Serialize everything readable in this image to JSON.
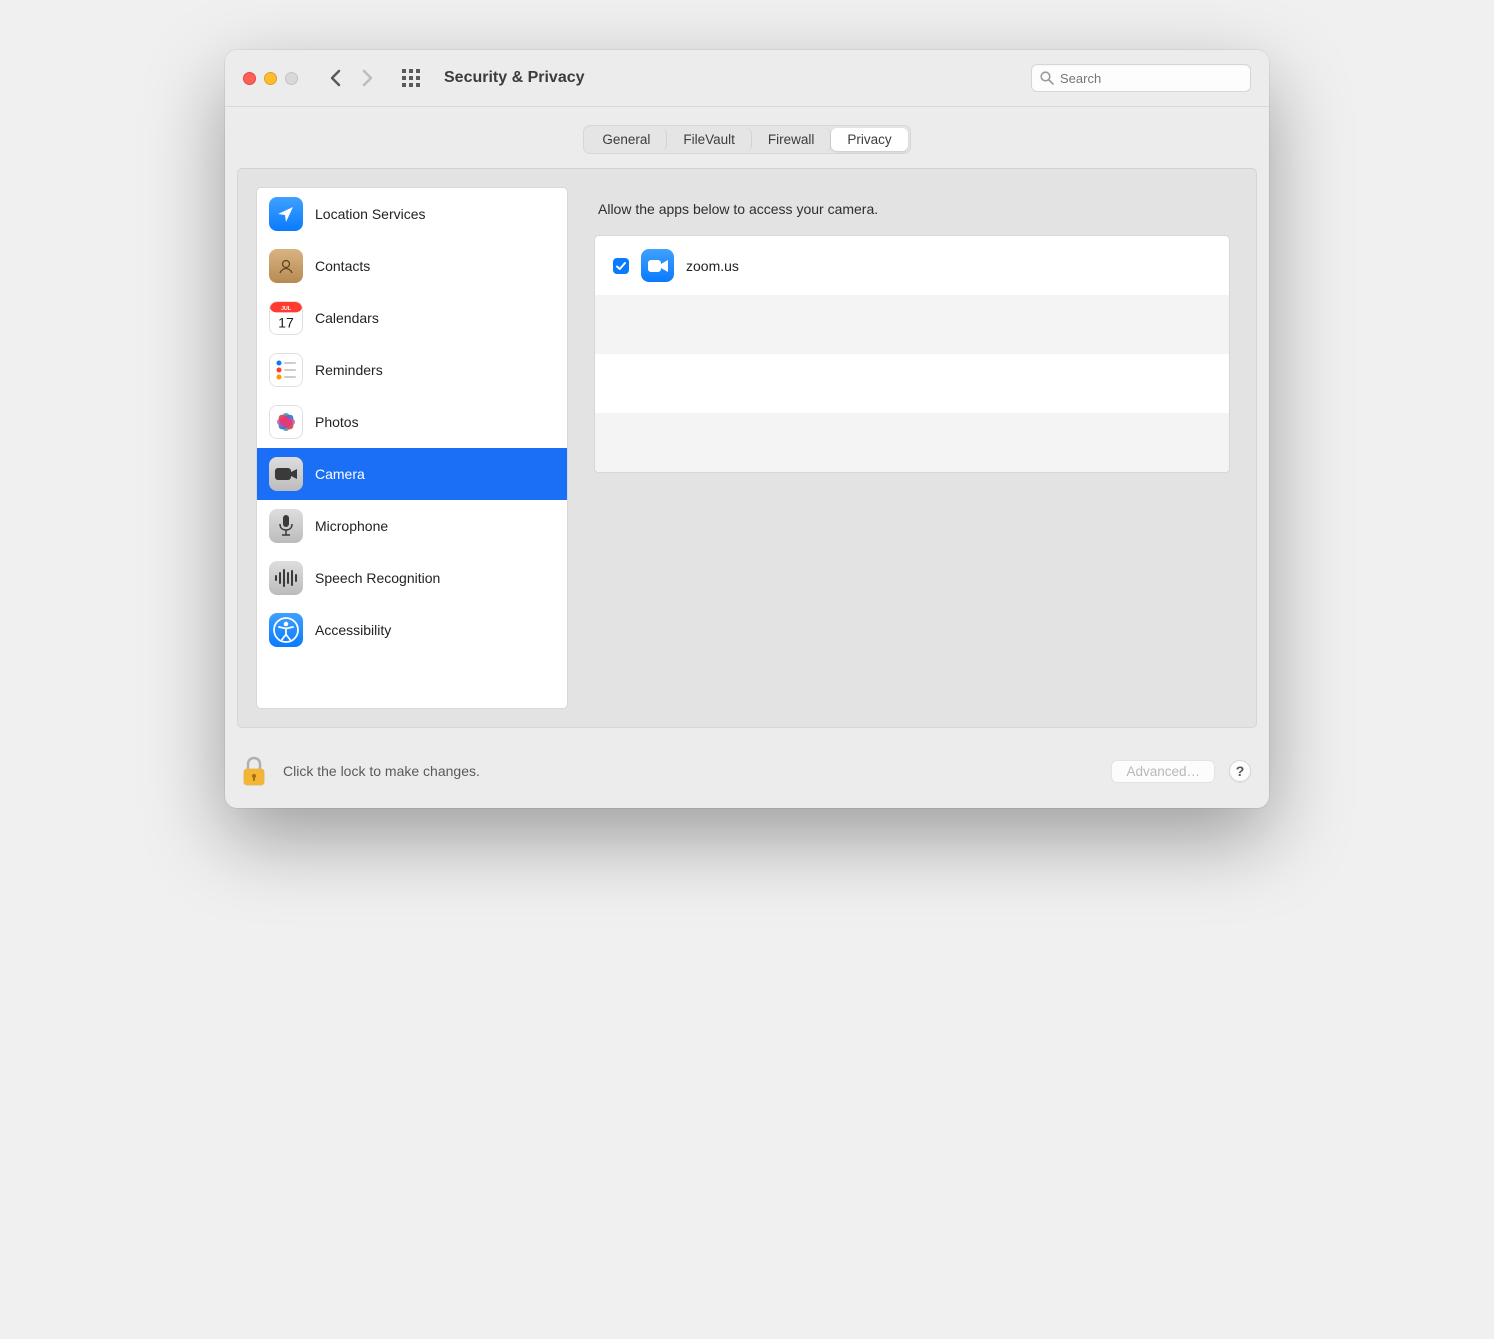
{
  "window": {
    "title": "Security & Privacy"
  },
  "search": {
    "placeholder": "Search"
  },
  "tabs": [
    {
      "label": "General",
      "active": false
    },
    {
      "label": "FileVault",
      "active": false
    },
    {
      "label": "Firewall",
      "active": false
    },
    {
      "label": "Privacy",
      "active": true
    }
  ],
  "sidebar": {
    "items": [
      {
        "label": "Location Services",
        "icon": "location-arrow-icon",
        "selected": false
      },
      {
        "label": "Contacts",
        "icon": "contacts-icon",
        "selected": false
      },
      {
        "label": "Calendars",
        "icon": "calendar-icon",
        "selected": false
      },
      {
        "label": "Reminders",
        "icon": "reminders-icon",
        "selected": false
      },
      {
        "label": "Photos",
        "icon": "photos-icon",
        "selected": false
      },
      {
        "label": "Camera",
        "icon": "camera-icon",
        "selected": true
      },
      {
        "label": "Microphone",
        "icon": "microphone-icon",
        "selected": false
      },
      {
        "label": "Speech Recognition",
        "icon": "speech-icon",
        "selected": false
      },
      {
        "label": "Accessibility",
        "icon": "accessibility-icon",
        "selected": false
      }
    ]
  },
  "content": {
    "heading": "Allow the apps below to access your camera.",
    "apps": [
      {
        "name": "zoom.us",
        "checked": true,
        "icon": "zoom-app-icon"
      }
    ]
  },
  "footer": {
    "lock_text": "Click the lock to make changes.",
    "advanced_label": "Advanced…",
    "help_label": "?"
  }
}
